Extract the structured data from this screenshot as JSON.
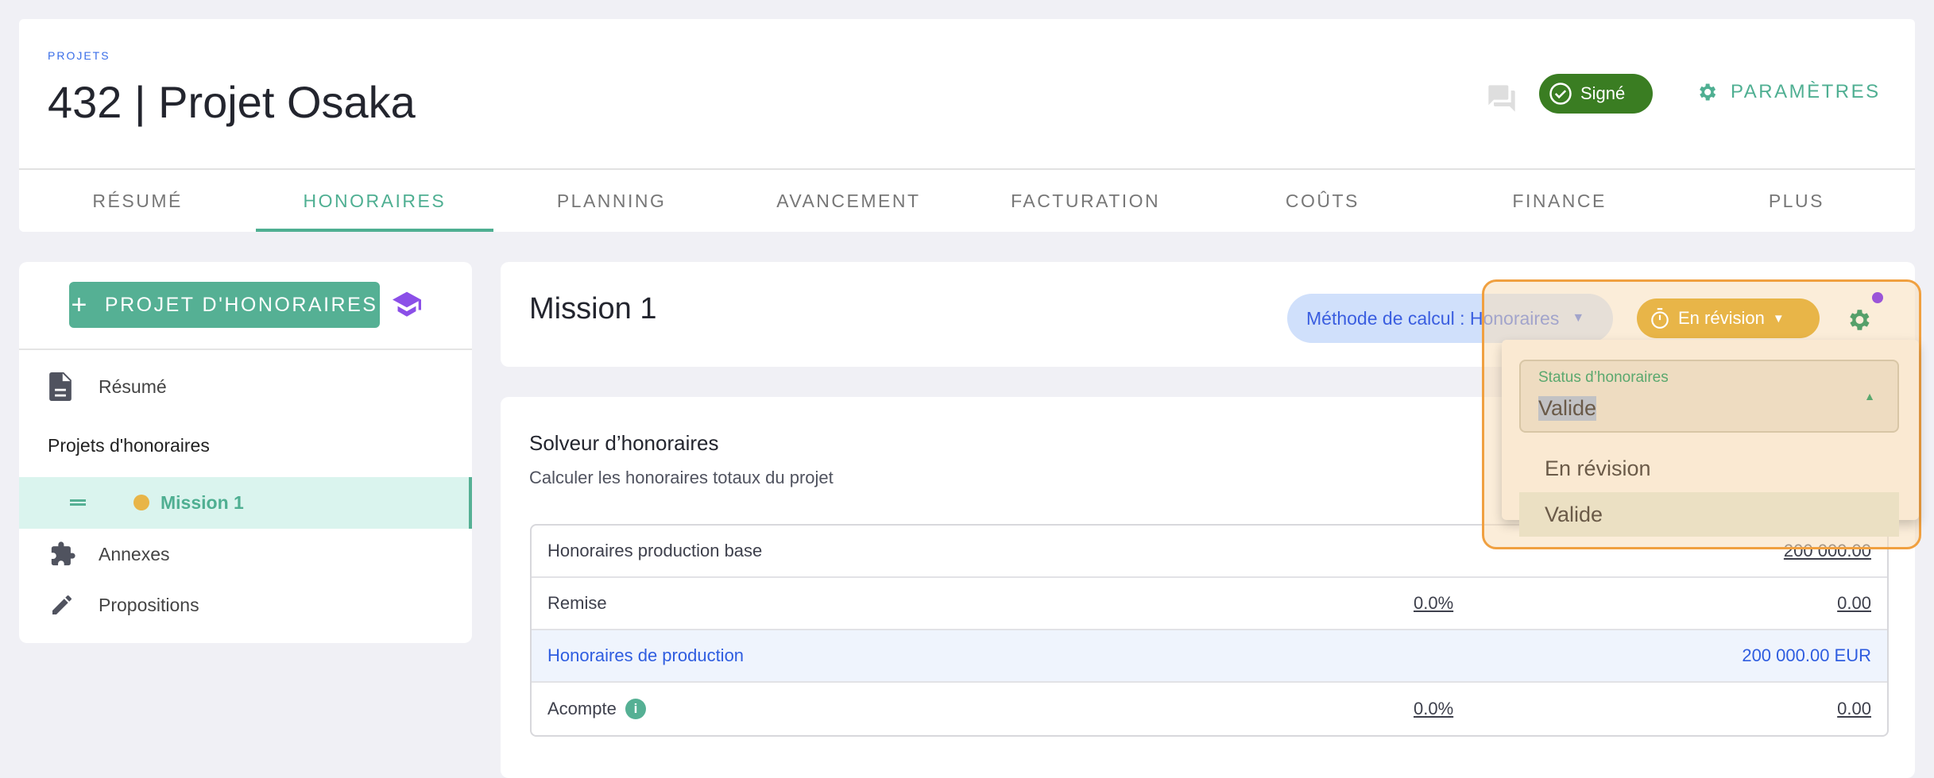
{
  "header": {
    "breadcrumb": "PROJETS",
    "title": "432 | Projet Osaka",
    "status_badge": "Signé",
    "settings_label": "PARAMÈTRES"
  },
  "tabs": [
    {
      "label": "RÉSUMÉ"
    },
    {
      "label": "HONORAIRES",
      "active": true
    },
    {
      "label": "PLANNING"
    },
    {
      "label": "AVANCEMENT"
    },
    {
      "label": "FACTURATION"
    },
    {
      "label": "COÛTS"
    },
    {
      "label": "FINANCE"
    },
    {
      "label": "PLUS"
    }
  ],
  "sidebar": {
    "add_button": "PROJET D'HONORAIRES",
    "items": [
      {
        "label": "Résumé",
        "icon": "document-icon"
      },
      {
        "label": "Projets d'honoraires"
      },
      {
        "label": "Mission 1",
        "status_color": "#e8b548"
      },
      {
        "label": "Annexes",
        "icon": "puzzle-icon"
      },
      {
        "label": "Propositions",
        "icon": "pencil-icon"
      }
    ]
  },
  "mission": {
    "title": "Mission 1",
    "method_label": "Méthode de calcul : Honoraires",
    "status_label": "En révision"
  },
  "solver": {
    "title": "Solveur d’honoraires",
    "subtitle": "Calculer les honoraires totaux du projet",
    "rows": [
      {
        "label": "Honoraires production base",
        "percent": "",
        "value": "200 000.00"
      },
      {
        "label": "Remise",
        "percent": "0.0%",
        "value": "0.00"
      },
      {
        "label": "Honoraires de production",
        "percent": "",
        "value": "200 000.00 EUR"
      },
      {
        "label": "Acompte",
        "percent": "0.0%",
        "value": "0.00"
      }
    ]
  },
  "status_dropdown": {
    "label": "Status d’honoraires",
    "value": "Valide",
    "options": [
      "En révision",
      "Valide"
    ]
  },
  "colors": {
    "accent": "#55b094",
    "signed": "#3a7d22",
    "review": "#e8b548",
    "highlight": "#f0a040"
  }
}
